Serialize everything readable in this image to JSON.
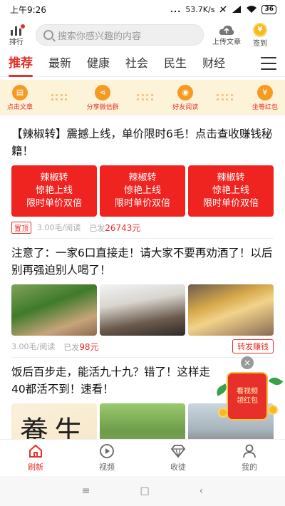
{
  "status_bar": {
    "time": "上午9:26",
    "signal_dots": "...",
    "speed": "53.7K/s",
    "battery": "36"
  },
  "top_bar": {
    "rank_label": "排行",
    "search_placeholder": "搜索你感兴趣的内容",
    "upload_label": "上传文章",
    "signin_label": "签到",
    "signin_coin": "¥"
  },
  "category_tabs": [
    "推荐",
    "最新",
    "健康",
    "社会",
    "民生",
    "财经"
  ],
  "action_strip": [
    {
      "label": "点击文章",
      "icon": "document-icon"
    },
    {
      "label": "分享微信群",
      "icon": "share-icon"
    },
    {
      "label": "好友阅读",
      "icon": "eye-icon"
    },
    {
      "label": "坐等红包",
      "icon": "red-envelope-icon"
    }
  ],
  "articles": [
    {
      "title": "【辣椒转】震撼上线，单价限时6毛！点击查收赚钱秘籍！",
      "banner_lines": [
        "辣椒转",
        "惊艳上线",
        "限时单价双倍"
      ],
      "pin": "置顶",
      "price": "3.00毛/阅读",
      "sent_label": "已发",
      "sent_value": "26743元"
    },
    {
      "title": "注意了：一家6口直接走！请大家不要再劝酒了！以后别再强迫别人喝了！",
      "price": "3.00毛/阅读",
      "sent_label": "已发",
      "sent_value": "98元",
      "forward": "转发赚钱"
    },
    {
      "title": "饭后百步走，能活九十九？错了！这样走40都活不到！速看！",
      "calligraphy": "養生"
    }
  ],
  "floating_pack": {
    "close": "×",
    "line1": "看视频",
    "line2": "领红包"
  },
  "bottom_nav": [
    {
      "label": "刷新",
      "icon": "home-icon"
    },
    {
      "label": "视频",
      "icon": "play-icon"
    },
    {
      "label": "收徒",
      "icon": "diamond-icon"
    },
    {
      "label": "我的",
      "icon": "user-icon"
    }
  ],
  "system_nav": {
    "menu": "≡",
    "home": "□",
    "back": "‹"
  },
  "colors": {
    "accent": "#e8302a",
    "strip_bg": "#fdf3d9",
    "icon_orange": "#f59a23"
  }
}
